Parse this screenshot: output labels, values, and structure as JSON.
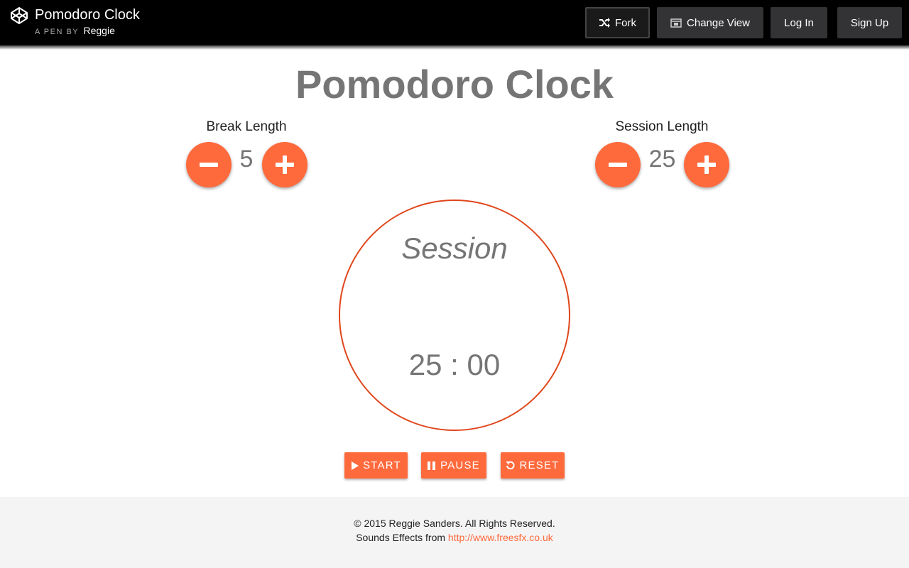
{
  "header": {
    "pen_title": "Pomodoro Clock",
    "pen_by_prefix": "A PEN BY",
    "author": "Reggie",
    "buttons": {
      "fork": "Fork",
      "change_view": "Change View",
      "log_in": "Log In",
      "sign_up": "Sign Up"
    }
  },
  "app": {
    "title": "Pomodoro Clock",
    "break": {
      "label": "Break Length",
      "value": "5"
    },
    "session": {
      "label": "Session Length",
      "value": "25"
    },
    "clock": {
      "mode": "Session",
      "time": "25 : 00"
    },
    "controls": {
      "start": "START",
      "pause": "PAUSE",
      "reset": "RESET"
    }
  },
  "footer": {
    "copyright": "© 2015 Reggie Sanders. All Rights Reserved.",
    "sounds_prefix": "Sounds Effects from",
    "sounds_link": "http://www.freesfx.co.uk"
  },
  "colors": {
    "accent": "#ff6a3d",
    "clock_ring": "#e0461b",
    "topbar": "#000000"
  },
  "icons": [
    "codepen-logo-icon",
    "fork-icon",
    "change-view-icon",
    "minus-icon",
    "plus-icon",
    "play-icon",
    "pause-icon",
    "reset-icon"
  ]
}
